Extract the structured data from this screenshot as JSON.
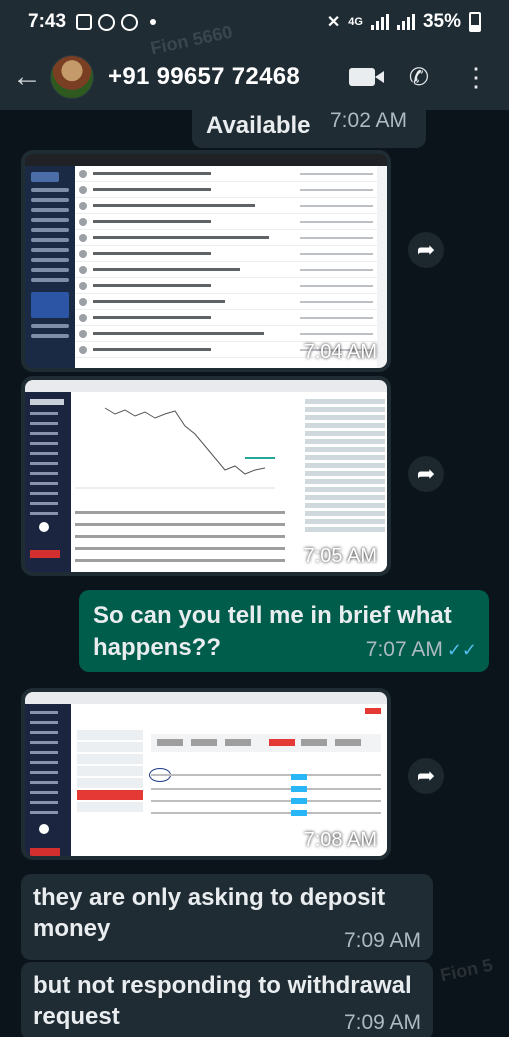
{
  "status_bar": {
    "time": "7:43",
    "network": "4G",
    "battery": "35%"
  },
  "header": {
    "contact": "+91 99657 72468"
  },
  "messages": [
    {
      "type": "text",
      "direction": "in",
      "text": "Available",
      "time": "7:02 AM"
    },
    {
      "type": "image",
      "direction": "in",
      "content": "gmail-inbox-screenshot",
      "time": "7:04 AM"
    },
    {
      "type": "image",
      "direction": "in",
      "content": "trading-platform-chart-screenshot",
      "time": "7:05 AM"
    },
    {
      "type": "text",
      "direction": "out",
      "text": "So can you tell me in brief what happens??",
      "time": "7:07 AM",
      "status": "read"
    },
    {
      "type": "image",
      "direction": "in",
      "content": "transaction-history-screenshot",
      "time": "7:08 AM"
    },
    {
      "type": "text",
      "direction": "in",
      "text": "they are only asking to deposit money",
      "time": "7:09 AM"
    },
    {
      "type": "text",
      "direction": "in",
      "text": "but not responding to withdrawal request",
      "time": "7:09 AM"
    }
  ],
  "colors": {
    "background": "#0b141a",
    "header": "#1f2c34",
    "incoming_bubble": "#202c33",
    "outgoing_bubble": "#005c4b",
    "read_ticks": "#53bdeb"
  }
}
